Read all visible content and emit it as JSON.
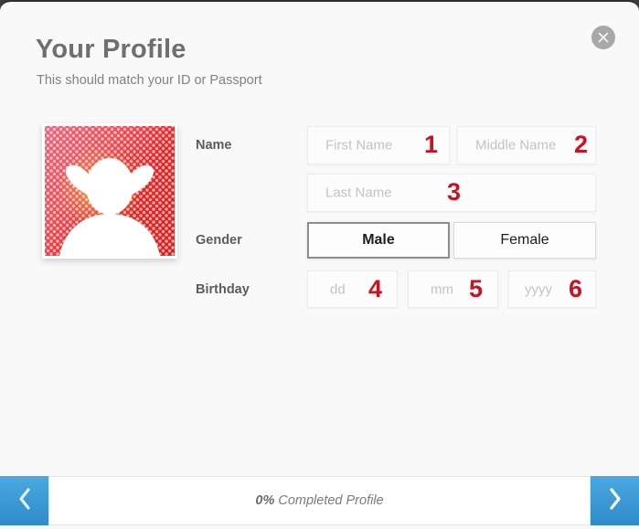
{
  "dialog": {
    "title": "Your Profile",
    "subtitle": "This should match your ID or Passport",
    "close_icon": "close-icon"
  },
  "avatar": {
    "alt": "profile-avatar-horned-silhouette"
  },
  "form": {
    "name": {
      "label": "Name",
      "fields": [
        {
          "placeholder": "First Name",
          "value": "",
          "marker": "1"
        },
        {
          "placeholder": "Middle Name",
          "value": "",
          "marker": "2"
        },
        {
          "placeholder": "Last Name",
          "value": "",
          "marker": "3"
        }
      ]
    },
    "gender": {
      "label": "Gender",
      "options": [
        {
          "label": "Male",
          "selected": true
        },
        {
          "label": "Female",
          "selected": false
        }
      ]
    },
    "birthday": {
      "label": "Birthday",
      "fields": [
        {
          "placeholder": "dd",
          "value": "",
          "marker": "4"
        },
        {
          "placeholder": "mm",
          "value": "",
          "marker": "5"
        },
        {
          "placeholder": "yyyy",
          "value": "",
          "marker": "6"
        }
      ]
    }
  },
  "footer": {
    "prev_icon": "chevron-left-icon",
    "next_icon": "chevron-right-icon",
    "progress_percent": "0%",
    "progress_label": "Completed Profile"
  },
  "colors": {
    "marker_red": "#cc1222",
    "accent_blue": "#3e9bd6",
    "background": "#f9f9f9",
    "title_gray": "#6f6f6f"
  }
}
